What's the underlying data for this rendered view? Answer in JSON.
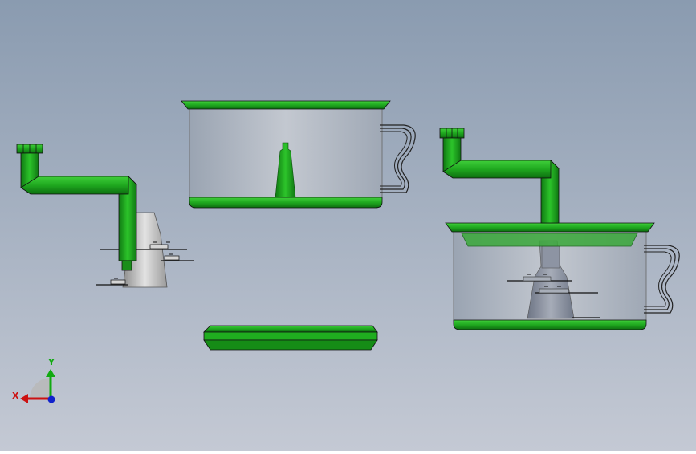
{
  "viewport": {
    "background_top": "#8a9bb0",
    "background_bottom": "#c4c9d4"
  },
  "colors": {
    "part_green": "#1fae1f",
    "part_green_dark": "#0f6e10",
    "part_green_light": "#4ccf40",
    "edge": "#1a1a1a",
    "glass": "#b4bcc8",
    "metal_gray": "#c8c8c8",
    "axis_x": "#cc1111",
    "axis_y": "#11aa11",
    "axis_z": "#1122cc"
  },
  "triad": {
    "x_label": "X",
    "y_label": "Y",
    "icon": "coordinate-triad-icon"
  }
}
